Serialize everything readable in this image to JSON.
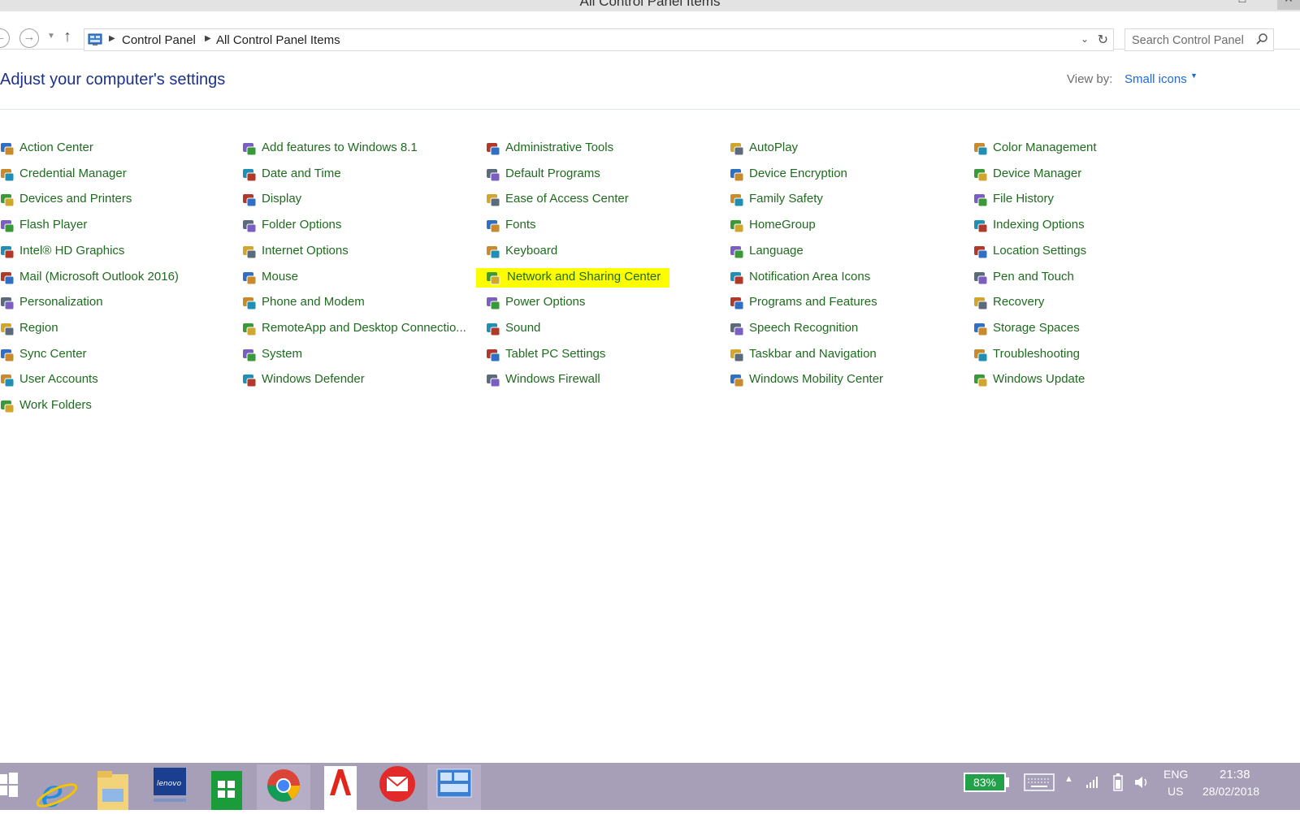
{
  "window": {
    "title": "All Control Panel Items"
  },
  "nav": {
    "breadcrumb": [
      "Control Panel",
      "All Control Panel Items"
    ],
    "search_placeholder": "Search Control Panel"
  },
  "header": {
    "title": "Adjust your computer's settings",
    "view_by_label": "View by:",
    "view_by_value": "Small icons"
  },
  "columns": [
    [
      "Action Center",
      "Credential Manager",
      "Devices and Printers",
      "Flash Player",
      "Intel® HD Graphics",
      "Mail (Microsoft Outlook 2016)",
      "Personalization",
      "Region",
      "Sync Center",
      "User Accounts",
      "Work Folders"
    ],
    [
      "Add features to Windows 8.1",
      "Date and Time",
      "Display",
      "Folder Options",
      "Internet Options",
      "Mouse",
      "Phone and Modem",
      "RemoteApp and Desktop Connectio...",
      "System",
      "Windows Defender"
    ],
    [
      "Administrative Tools",
      "Default Programs",
      "Ease of Access Center",
      "Fonts",
      "Keyboard",
      "Network and Sharing Center",
      "Power Options",
      "Sound",
      "Tablet PC Settings",
      "Windows Firewall"
    ],
    [
      "AutoPlay",
      "Device Encryption",
      "Family Safety",
      "HomeGroup",
      "Language",
      "Notification Area Icons",
      "Programs and Features",
      "Speech Recognition",
      "Taskbar and Navigation",
      "Windows Mobility Center"
    ],
    [
      "Color Management",
      "Device Manager",
      "File History",
      "Indexing Options",
      "Location Settings",
      "Pen and Touch",
      "Recovery",
      "Storage Spaces",
      "Troubleshooting",
      "Windows Update"
    ]
  ],
  "highlighted_item": "Network and Sharing Center",
  "highlight_color": "#fdfd00",
  "link_color": "#1f6b1f",
  "taskbar": {
    "apps": [
      "internet-explorer",
      "file-explorer",
      "lenovo",
      "store",
      "chrome",
      "adobe-reader",
      "mail",
      "control-panel"
    ],
    "active_app": "control-panel",
    "battery": "83%",
    "lang": "ENG",
    "lang_region": "US",
    "time": "21:38",
    "date": "28/02/2018"
  }
}
